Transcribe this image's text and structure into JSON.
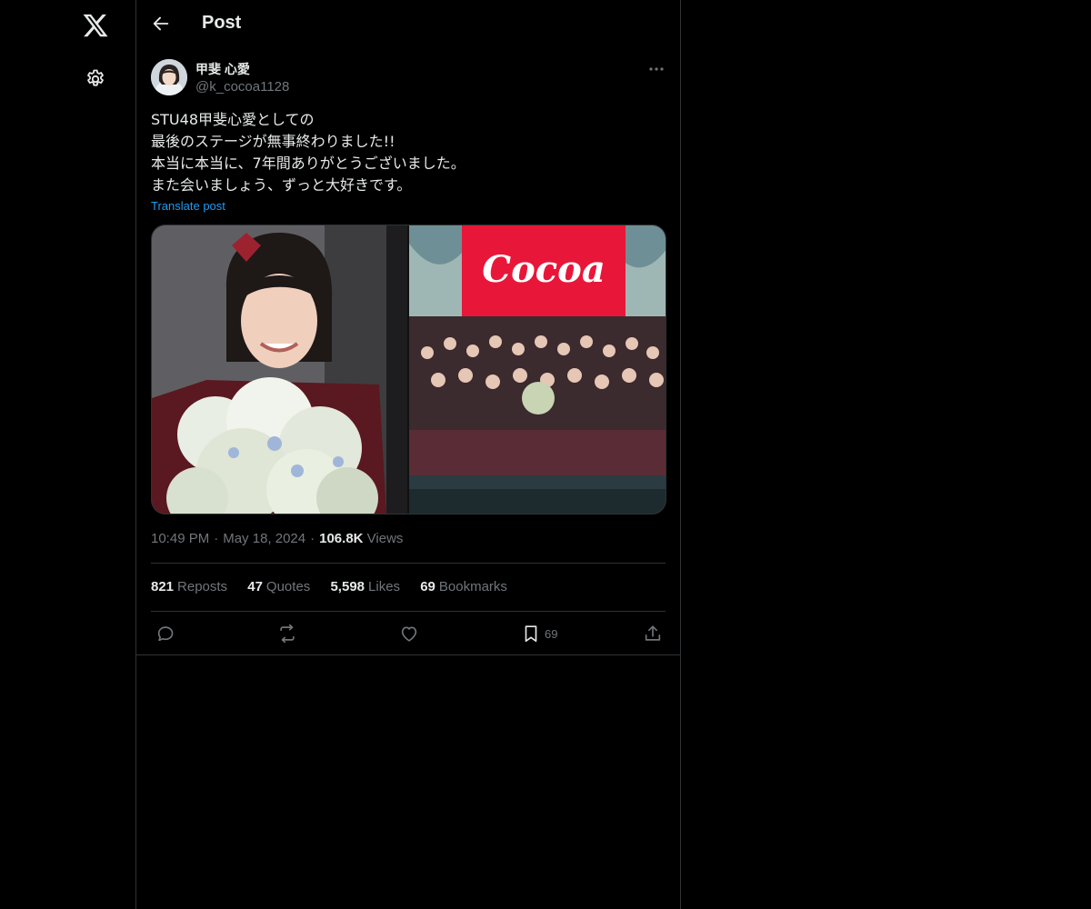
{
  "header": {
    "title": "Post"
  },
  "author": {
    "name": "甲斐 心愛",
    "handle": "@k_cocoa1128"
  },
  "post": {
    "lines": [
      "STU48甲斐心愛としての",
      "最後のステージが無事終わりました!!",
      "本当に本当に、7年間ありがとうございました。",
      "また会いましょう、ずっと大好きです。"
    ],
    "translate_label": "Translate post",
    "media_banner_text": "Cocoa"
  },
  "meta": {
    "time": "10:49 PM",
    "date": "May 18, 2024",
    "views_count": "106.8K",
    "views_label": "Views"
  },
  "stats": [
    {
      "count": "821",
      "label": "Reposts"
    },
    {
      "count": "47",
      "label": "Quotes"
    },
    {
      "count": "5,598",
      "label": "Likes"
    },
    {
      "count": "69",
      "label": "Bookmarks"
    }
  ],
  "actions": {
    "reply": {
      "icon": "reply-icon"
    },
    "repost": {
      "icon": "repost-icon"
    },
    "like": {
      "icon": "heart-icon"
    },
    "bookmark": {
      "icon": "bookmark-icon",
      "count": "69"
    },
    "share": {
      "icon": "share-icon"
    }
  },
  "colors": {
    "background": "#000000",
    "text": "#e7e9ea",
    "muted": "#71767b",
    "accent": "#1d9bf0",
    "border": "#2f3336"
  }
}
